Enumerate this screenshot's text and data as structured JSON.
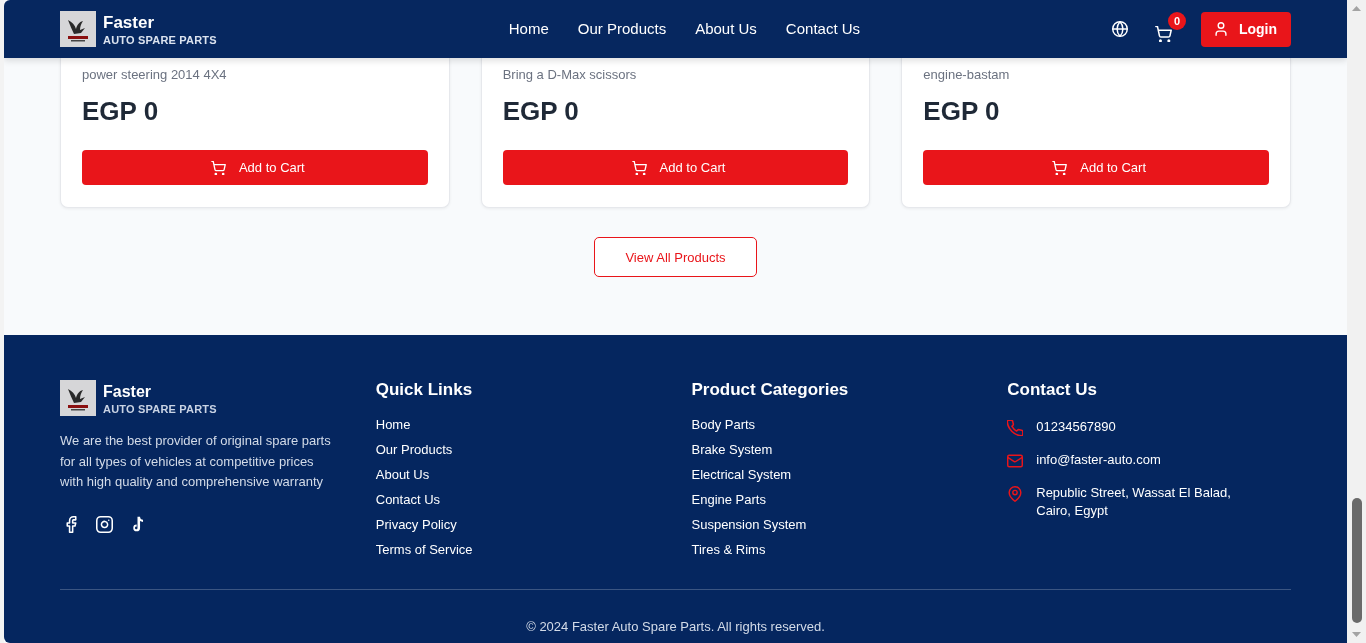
{
  "header": {
    "brand": {
      "name": "Faster",
      "tagline": "AUTO SPARE PARTS"
    },
    "nav": [
      "Home",
      "Our Products",
      "About Us",
      "Contact Us"
    ],
    "cart_count": "0",
    "login": "Login"
  },
  "products": [
    {
      "name": "power steering 2014 4X4",
      "price": "EGP 0",
      "button": "Add to Cart"
    },
    {
      "name": "Bring a D-Max scissors",
      "price": "EGP 0",
      "button": "Add to Cart"
    },
    {
      "name": "engine-bastam",
      "price": "EGP 0",
      "button": "Add to Cart"
    }
  ],
  "view_all": "View All Products",
  "footer": {
    "brand": {
      "name": "Faster",
      "tagline": "AUTO SPARE PARTS"
    },
    "description": "We are the best provider of original spare parts for all types of vehicles at competitive prices with high quality and comprehensive warranty",
    "quick_links": {
      "title": "Quick Links",
      "items": [
        "Home",
        "Our Products",
        "About Us",
        "Contact Us",
        "Privacy Policy",
        "Terms of Service"
      ]
    },
    "categories": {
      "title": "Product Categories",
      "items": [
        "Body Parts",
        "Brake System",
        "Electrical System",
        "Engine Parts",
        "Suspension System",
        "Tires & Rims"
      ]
    },
    "contact": {
      "title": "Contact Us",
      "items": [
        {
          "kind": "phone",
          "text": "01234567890"
        },
        {
          "kind": "email",
          "text": "info@faster-auto.com"
        },
        {
          "kind": "location",
          "text": "Republic Street, Wassat El Balad, Cairo, Egypt"
        }
      ]
    },
    "copyright": "© 2024 Faster Auto Spare Parts. All rights reserved."
  }
}
